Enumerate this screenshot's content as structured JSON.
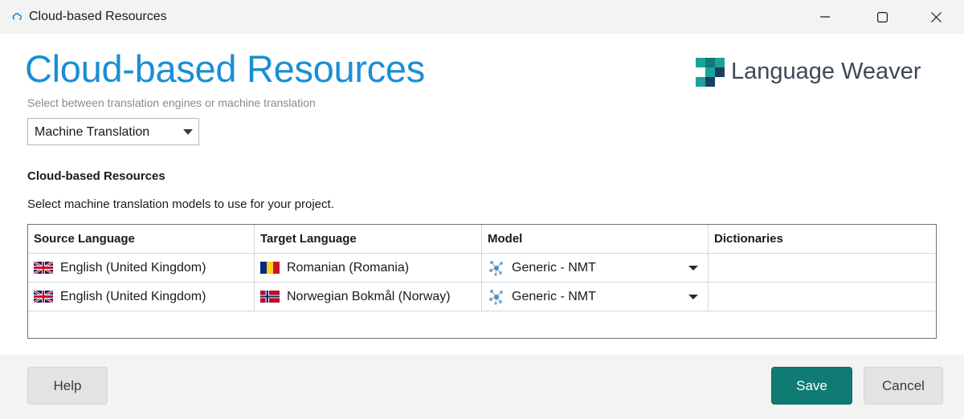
{
  "window": {
    "title": "Cloud-based Resources",
    "icon": "cloud-icon",
    "controls": [
      "minimize-icon",
      "maximize-icon",
      "close-icon"
    ]
  },
  "header": {
    "title": "Cloud-based Resources",
    "subtitle": "Select between translation engines or machine translation",
    "logo_text": "Language Weaver",
    "accent_color": "#1a8fd4"
  },
  "resource_type": {
    "selected": "Machine Translation"
  },
  "section": {
    "title": "Cloud-based Resources",
    "description": "Select machine translation models to use for your project."
  },
  "table": {
    "columns": [
      "Source Language",
      "Target Language",
      "Model",
      "Dictionaries"
    ],
    "rows": [
      {
        "source": "English (United Kingdom)",
        "source_flag": "uk-flag-icon",
        "target": "Romanian (Romania)",
        "target_flag": "romania-flag-icon",
        "model": "Generic - NMT",
        "dictionaries": ""
      },
      {
        "source": "English (United Kingdom)",
        "source_flag": "uk-flag-icon",
        "target": "Norwegian Bokmål (Norway)",
        "target_flag": "norway-flag-icon",
        "model": "Generic - NMT",
        "dictionaries": ""
      }
    ]
  },
  "footer": {
    "help_label": "Help",
    "save_label": "Save",
    "cancel_label": "Cancel",
    "save_color": "#0f7b73"
  }
}
